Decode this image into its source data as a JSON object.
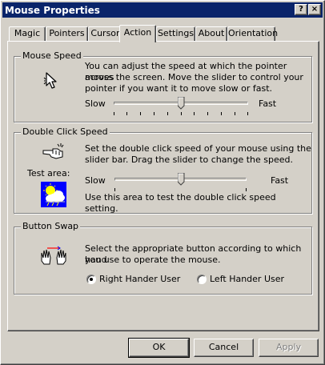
{
  "window": {
    "title": "Mouse Properties",
    "help_glyph": "?",
    "close_glyph": "×"
  },
  "tabs": [
    {
      "label": "Magic"
    },
    {
      "label": "Pointers"
    },
    {
      "label": "Cursor"
    },
    {
      "label": "Action"
    },
    {
      "label": "Settings"
    },
    {
      "label": "About"
    },
    {
      "label": "Orientation"
    }
  ],
  "active_tab": "Action",
  "mouse_speed": {
    "legend": "Mouse Speed",
    "line1": "You can adjust the speed at which the pointer moves",
    "line2": "across the screen. Move the slider to control your",
    "line3": "pointer if you want it to move slow or fast.",
    "slow": "Slow",
    "fast": "Fast",
    "value": 0.5
  },
  "double_click": {
    "legend": "Double Click Speed",
    "line1": "Set the double click speed of your mouse using the",
    "line2": "slider bar. Drag the slider to change the speed.",
    "test_area": "Test area:",
    "slow": "Slow",
    "fast": "Fast",
    "value": 0.5,
    "test_hint": "Use this area to test the double click speed setting."
  },
  "button_swap": {
    "legend": "Button Swap",
    "line1": "Select the appropriate button according to which hand",
    "line2": "you use to operate the mouse.",
    "right_label": "Right Hander User",
    "left_label": "Left Hander User",
    "selected": "right"
  },
  "buttons": {
    "ok": "OK",
    "cancel": "Cancel",
    "apply": "Apply"
  }
}
